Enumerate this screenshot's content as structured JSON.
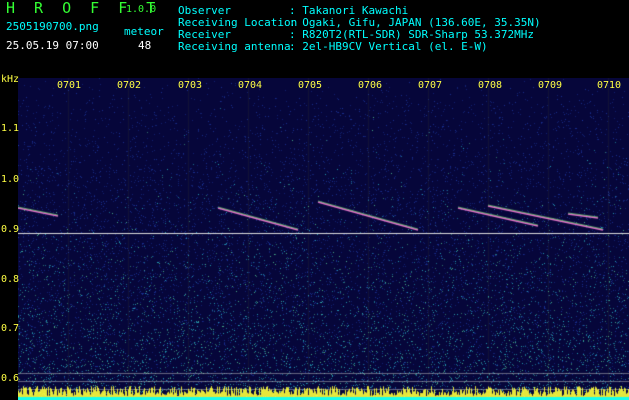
{
  "header": {
    "app_title": "H R O F F T",
    "version": "1.0.0",
    "filename": "2505190700.png",
    "datetime": "25.05.19 07:00",
    "meteor_label": "meteor",
    "meteor_count": "48",
    "observer_label": "Observer",
    "observer_value": ": Takanori Kawachi",
    "location_label": "Receiving Location",
    "location_value": ": Ogaki, Gifu, JAPAN (136.60E, 35.35N)",
    "receiver_label": "Receiver",
    "receiver_value": ": R820T2(RTL-SDR) SDR-Sharp 53.372MHz",
    "antenna_label": "Receiving antenna",
    "antenna_value": ": 2el-HB9CV Vertical (el. E-W)"
  },
  "axis": {
    "unit": "kHz",
    "y_ticks": [
      "1.1",
      "1.0",
      "0.9",
      "0.8",
      "0.7",
      "0.6"
    ],
    "x_ticks": [
      "0701",
      "0702",
      "0703",
      "0704",
      "0705",
      "0706",
      "0707",
      "0708",
      "0709",
      "0710"
    ]
  },
  "colors": {
    "background": "#000000",
    "spectrogram": "#06063a",
    "carrier_line": "#dddddd",
    "labels": "#ffff44",
    "title": "#33ff33",
    "info": "#00ffff"
  }
}
